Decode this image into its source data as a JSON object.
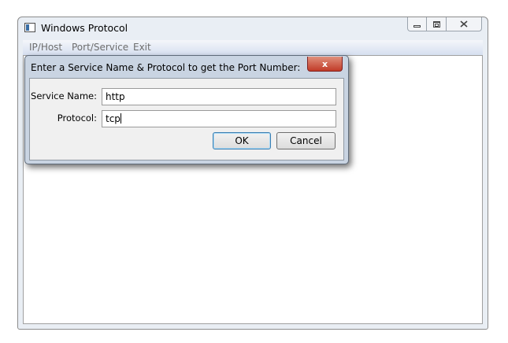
{
  "window": {
    "title": "Windows Protocol",
    "icon": "app-window-icon",
    "caption_buttons": {
      "minimize": "minimize-icon",
      "maximize": "maximize-icon",
      "close": "close-icon"
    }
  },
  "menu": {
    "items": [
      {
        "label": "IP/Host"
      },
      {
        "label": "Port/Service"
      },
      {
        "label": "Exit"
      }
    ]
  },
  "dialog": {
    "title": "Enter a Service Name & Protocol to get the Port Number:",
    "close_glyph": "x",
    "service_label": "Service Name:",
    "service_value": "http",
    "protocol_label": "Protocol:",
    "protocol_value": "tcp",
    "ok_label": "OK",
    "cancel_label": "Cancel"
  },
  "colors": {
    "close_button": "#c13b28",
    "menubar": "#d6dff0",
    "dialog_frame": "#c9d4e2"
  }
}
